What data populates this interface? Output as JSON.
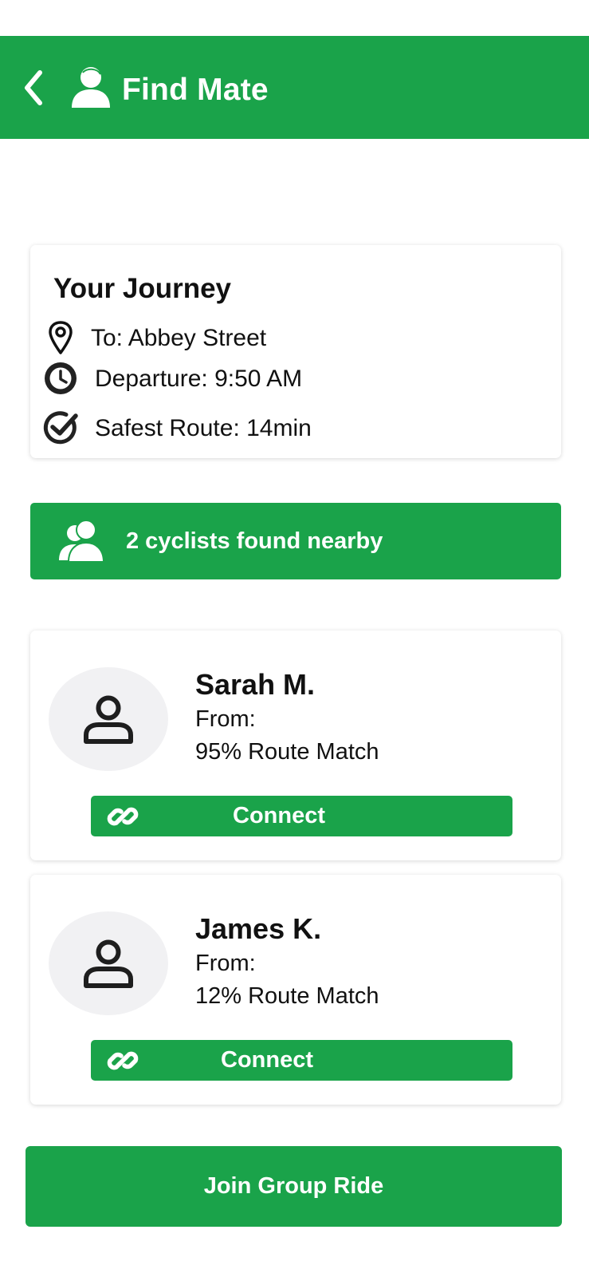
{
  "header": {
    "title": "Find Mate",
    "back_icon": "chevron-left-icon",
    "person_icon": "person-icon"
  },
  "journey": {
    "title": "Your Journey",
    "destination": "To: Abbey Street",
    "departure": "Departure: 9:50 AM",
    "route": "Safest Route: 14min"
  },
  "found": {
    "label": "2 cyclists found nearby",
    "icon": "group-icon"
  },
  "mates": [
    {
      "name": "Sarah M.",
      "from": "From:",
      "match": "95% Route Match",
      "connect_label": "Connect"
    },
    {
      "name": "James K.",
      "from": "From:",
      "match": "12% Route Match",
      "connect_label": "Connect"
    }
  ],
  "join_label": "Join Group Ride",
  "colors": {
    "brand_green": "#1aa34a",
    "card_bg": "#ffffff",
    "avatar_bg": "#f1f1f3"
  }
}
